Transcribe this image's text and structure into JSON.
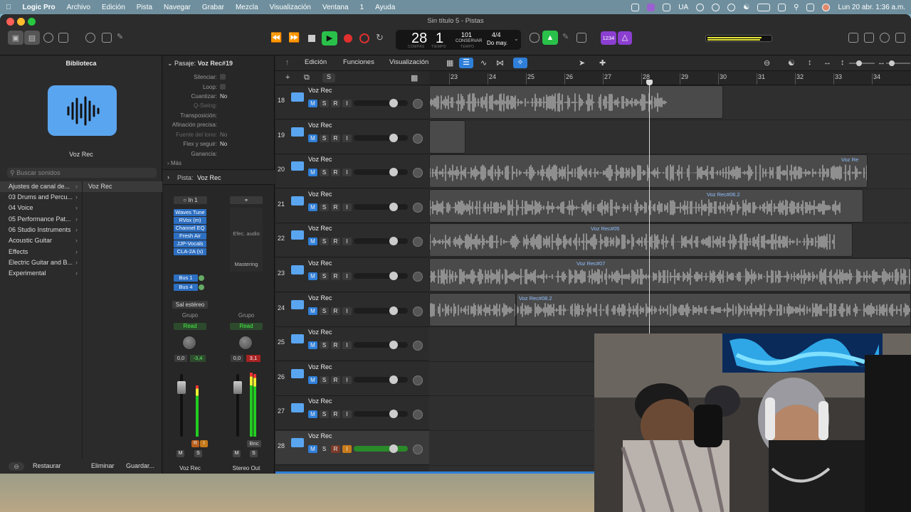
{
  "menubar": {
    "app": "Logic Pro",
    "items": [
      "Archivo",
      "Edición",
      "Pista",
      "Navegar",
      "Grabar",
      "Mezcla",
      "Visualización",
      "Ventana",
      "1",
      "Ayuda"
    ],
    "locale": "UA",
    "clock": "Lun 20 abr.  1:36 a.m."
  },
  "window": {
    "title": "Sin título 5 - Pistas"
  },
  "lcd": {
    "bar": "28",
    "beat": "1",
    "bar_label": "COMPÁS",
    "beat_label": "TIEMPO",
    "tempo": "101",
    "tempo_mode": "CONSERVAR",
    "tempo_label": "TEMPO",
    "signature": "4/4",
    "key": "Do may."
  },
  "toolbar": {
    "count_in": "1234"
  },
  "library": {
    "title": "Biblioteca",
    "patch_name": "Voz Rec",
    "search_placeholder": "Buscar sonidos",
    "categories": [
      "Ajustes de canal de...",
      "03 Drums and Percu...",
      "04 Voice",
      "05 Performance Pat...",
      "06 Studio Instruments",
      "Acoustic Guitar",
      "Effects",
      "Electric Guitar and B...",
      "Experimental"
    ],
    "selected_patch": "Voz Rec",
    "restore": "Restaurar",
    "delete": "Eliminar",
    "save": "Guardar..."
  },
  "inspector": {
    "region_header": "Pasaje:",
    "region_name": "Voz Rec#19",
    "params": [
      {
        "label": "Silenciar:",
        "value": ""
      },
      {
        "label": "Loop:",
        "value": ""
      },
      {
        "label": "Cuantizar:",
        "value": "No"
      },
      {
        "label": "Q-Swing:",
        "value": ""
      },
      {
        "label": "Transposición:",
        "value": ""
      },
      {
        "label": "Afinación precisa:",
        "value": ""
      },
      {
        "label": "Fuente del tono:",
        "value": "No"
      },
      {
        "label": "Flex y seguir:",
        "value": "No"
      },
      {
        "label": "Ganancia:",
        "value": ""
      }
    ],
    "more": "Más",
    "track_header": "Pista:",
    "track_name": "Voz Rec",
    "input": "In 1",
    "plugins": [
      "Waves Tune",
      "RVox (m)",
      "Channel EQ",
      "Fresh Air",
      "JJP-Vocals",
      "CLA-2A (s)"
    ],
    "sends": [
      "Bus 1",
      "Bus 4"
    ],
    "output": "Sal estéreo",
    "group": "Grupo",
    "automation": "Read",
    "vol_a": "0,0",
    "peak_a": "-3,4",
    "vol_b": "0,0",
    "peak_b": "3,1",
    "audio_fx": "Efec. audio",
    "mastering": "Mastering",
    "bnc": "Bnc",
    "strip_a": "Voz Rec",
    "strip_b": "Stereo Out",
    "group_b": "Grupo",
    "automation_b": "Read"
  },
  "tracks_toolbar": {
    "menus": [
      "Edición",
      "Funciones",
      "Visualización"
    ]
  },
  "ruler": [
    "23",
    "24",
    "25",
    "26",
    "27",
    "28",
    "29",
    "30",
    "31",
    "32",
    "33",
    "34"
  ],
  "tracks": [
    {
      "n": "18",
      "name": "Voz Rec"
    },
    {
      "n": "19",
      "name": "Voz Rec"
    },
    {
      "n": "20",
      "name": "Voz Rec"
    },
    {
      "n": "21",
      "name": "Voz Rec"
    },
    {
      "n": "22",
      "name": "Voz Rec"
    },
    {
      "n": "23",
      "name": "Voz Rec"
    },
    {
      "n": "24",
      "name": "Voz Rec"
    },
    {
      "n": "25",
      "name": "Voz Rec"
    },
    {
      "n": "26",
      "name": "Voz Rec"
    },
    {
      "n": "27",
      "name": "Voz Rec"
    },
    {
      "n": "28",
      "name": "Voz Rec"
    }
  ],
  "track_buttons": {
    "m": "M",
    "s": "S",
    "r": "R",
    "i": "I"
  },
  "regions": {
    "r20": "Voz Re",
    "r21": "Voz Rec#06.2",
    "r22": "Voz Rec#05",
    "r23": "Voz Rec#07",
    "r24": "Voz Rec#08.2"
  },
  "colors": {
    "accent": "#2f7fd9",
    "play": "#29c14a",
    "record": "#e0302f",
    "region_label": "#8fbfff"
  }
}
